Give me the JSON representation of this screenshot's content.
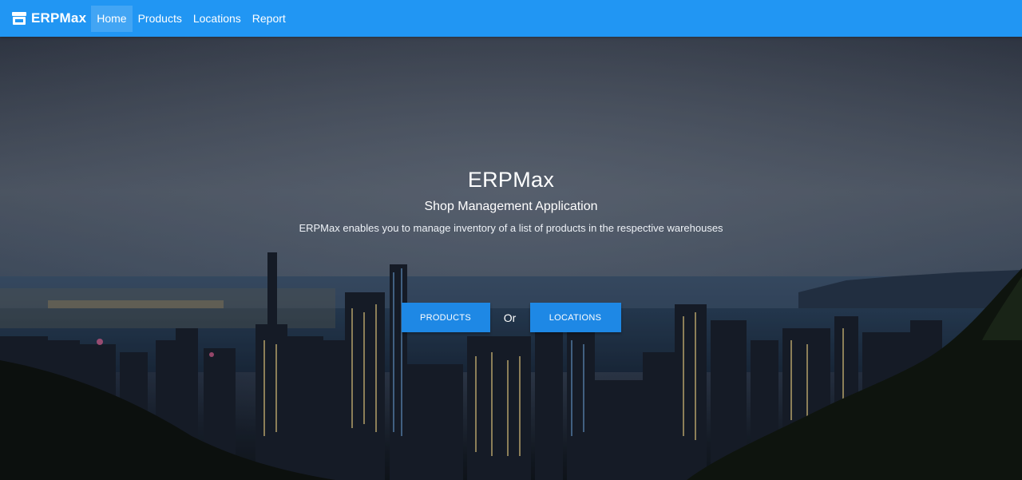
{
  "navbar": {
    "brand": "ERPMax",
    "brand_icon": "store-icon",
    "links": [
      {
        "label": "Home",
        "active": true
      },
      {
        "label": "Products",
        "active": false
      },
      {
        "label": "Locations",
        "active": false
      },
      {
        "label": "Report",
        "active": false
      }
    ],
    "color": "#2196f3"
  },
  "hero": {
    "title": "ERPMax",
    "subtitle": "Shop Management Application",
    "description": "ERPMax enables you to manage inventory of a list of products in the respective warehouses",
    "primary_button": "PRODUCTS",
    "separator": "Or",
    "secondary_button": "LOCATIONS",
    "button_color": "#1e88e5",
    "background": "night city skyline photo"
  }
}
